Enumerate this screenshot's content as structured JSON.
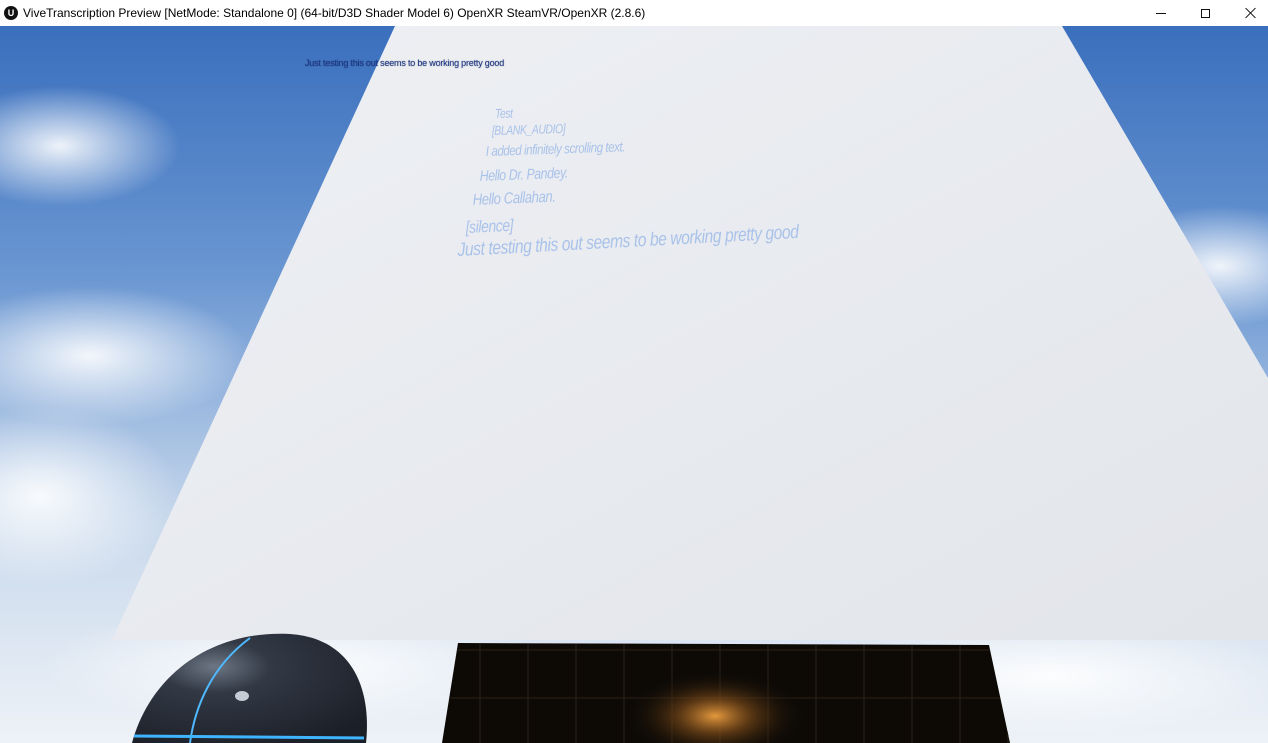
{
  "window": {
    "app_icon": "unreal-engine-logo",
    "app_icon_glyph": "U",
    "title": "ViveTranscription Preview [NetMode: Standalone 0]  (64-bit/D3D Shader Model 6) OpenXR SteamVR/OpenXR (2.8.6)",
    "controls": {
      "minimize": "minimize-icon",
      "maximize": "maximize-icon",
      "close": "close-icon"
    }
  },
  "viewport": {
    "debug_message": "Just testing this out seems to be working pretty good",
    "transcript_lines": [
      "Test",
      "[BLANK_AUDIO]",
      "I added infinitely scrolling text.",
      "Hello Dr. Pandey.",
      "Hello Callahan.",
      "[silence]",
      "Just testing this out seems to be working pretty good"
    ],
    "colors": {
      "sky_top": "#3f74c0",
      "sky_bottom": "#e6edf5",
      "wall": "#e9ecf1",
      "debug_text": "#1e3a8c",
      "transcript_text": "#a9c2ea",
      "helmet": "#2d3440",
      "helmet_trim": "#3fb4ff",
      "floor_panel": "#0c0905",
      "floor_glow": "#b07028"
    }
  }
}
